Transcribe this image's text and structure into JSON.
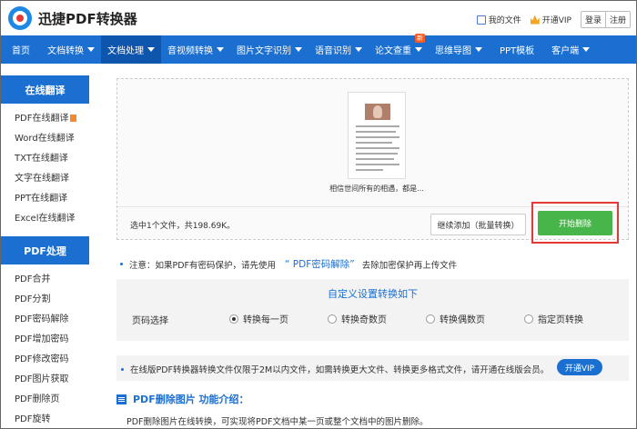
{
  "header": {
    "brand": "迅捷PDF转换器",
    "my_files": "我的文件",
    "open_vip": "开通VIP",
    "login": "登录",
    "register": "注册"
  },
  "nav": {
    "items": [
      {
        "label": "首页",
        "has_caret": false
      },
      {
        "label": "文档转换",
        "has_caret": true
      },
      {
        "label": "文档处理",
        "has_caret": true,
        "active": true
      },
      {
        "label": "音视频转换",
        "has_caret": true
      },
      {
        "label": "图片文字识别",
        "has_caret": true
      },
      {
        "label": "语音识别",
        "has_caret": true
      },
      {
        "label": "论文查重",
        "has_caret": true,
        "badge": "新"
      },
      {
        "label": "思维导图",
        "has_caret": true
      },
      {
        "label": "PPT模板",
        "has_caret": false
      },
      {
        "label": "客户端",
        "has_caret": true
      }
    ]
  },
  "sidebar": {
    "section1_title": "在线翻译",
    "section1_items": [
      "PDF在线翻译",
      "Word在线翻译",
      "TXT在线翻译",
      "文字在线翻译",
      "PPT在线翻译",
      "Excel在线翻译"
    ],
    "section2_title": "PDF处理",
    "section2_items": [
      "PDF合并",
      "PDF分割",
      "PDF密码解除",
      "PDF增加密码",
      "PDF修改密码",
      "PDF图片获取",
      "PDF删除页",
      "PDF旋转"
    ]
  },
  "upload": {
    "file_caption": "相信世间所有的相遇，都是...",
    "selected_info": "选中1个文件，共198.69K。",
    "continue_button": "继续添加（批量转换）",
    "start_button": "开始删除"
  },
  "notice": {
    "prefix": "注意：如果PDF有密码保护，请先使用",
    "link": "“ PDF密码解除”",
    "suffix": "去除加密保护再上传文件"
  },
  "settings": {
    "title": "自定义设置转换如下",
    "page_select_label": "页码选择",
    "options": [
      {
        "label": "转换每一页",
        "selected": true
      },
      {
        "label": "转换奇数页",
        "selected": false
      },
      {
        "label": "转换偶数页",
        "selected": false
      },
      {
        "label": "指定页转换",
        "selected": false
      }
    ]
  },
  "vip_note": {
    "text": "在线版PDF转换器转换文件仅限于2M以内文件，如需转换更大文件、转换更多格式文件，请开通在线版会员。",
    "button": "开通VIP"
  },
  "intro": {
    "title": "PDF删除图片 功能介绍：",
    "desc": "PDF删除图片在线转换，可实现将PDF文档中某一页或整个文档中的图片删除。"
  },
  "colors": {
    "brand_blue": "#1a6fd0",
    "nav_active": "#0e55ad",
    "start_green": "#48b54a",
    "highlight_red": "#e53935"
  }
}
